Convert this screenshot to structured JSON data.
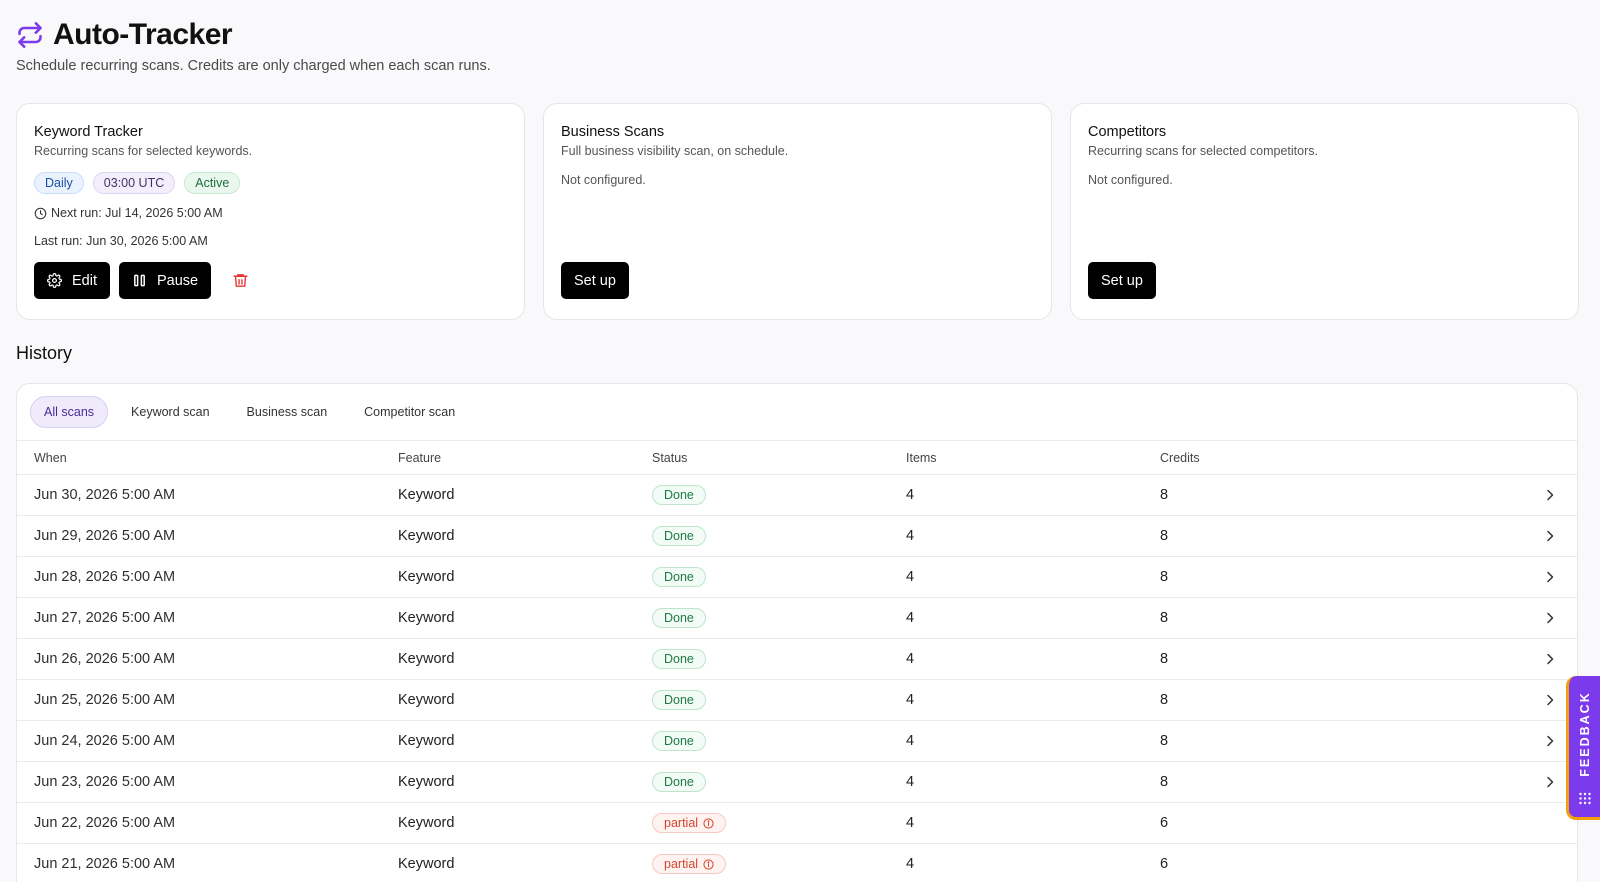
{
  "header": {
    "title": "Auto-Tracker",
    "subtitle": "Schedule recurring scans. Credits are only charged when each scan runs."
  },
  "cards": {
    "keyword": {
      "title": "Keyword Tracker",
      "description": "Recurring scans for selected keywords.",
      "tags": [
        "Daily",
        "03:00 UTC",
        "Active"
      ],
      "next_run": "Next run: Jul 14, 2026 5:00 AM",
      "last_run": "Last run: Jun 30, 2026 5:00 AM",
      "edit_label": "Edit",
      "pause_label": "Pause"
    },
    "business": {
      "title": "Business Scans",
      "description": "Full business visibility scan, on schedule.",
      "status": "Not configured.",
      "setup_label": "Set up"
    },
    "competitors": {
      "title": "Competitors",
      "description": "Recurring scans for selected competitors.",
      "status": "Not configured.",
      "setup_label": "Set up"
    }
  },
  "history": {
    "title": "History",
    "filters": [
      "All scans",
      "Keyword scan",
      "Business scan",
      "Competitor scan"
    ],
    "active_filter": "All scans",
    "columns": [
      "When",
      "Feature",
      "Status",
      "Items",
      "Credits"
    ],
    "rows": [
      {
        "when": "Jun 30, 2026 5:00 AM",
        "feature": "Keyword",
        "status": "Done",
        "items": "4",
        "credits": "8"
      },
      {
        "when": "Jun 29, 2026 5:00 AM",
        "feature": "Keyword",
        "status": "Done",
        "items": "4",
        "credits": "8"
      },
      {
        "when": "Jun 28, 2026 5:00 AM",
        "feature": "Keyword",
        "status": "Done",
        "items": "4",
        "credits": "8"
      },
      {
        "when": "Jun 27, 2026 5:00 AM",
        "feature": "Keyword",
        "status": "Done",
        "items": "4",
        "credits": "8"
      },
      {
        "when": "Jun 26, 2026 5:00 AM",
        "feature": "Keyword",
        "status": "Done",
        "items": "4",
        "credits": "8"
      },
      {
        "when": "Jun 25, 2026 5:00 AM",
        "feature": "Keyword",
        "status": "Done",
        "items": "4",
        "credits": "8"
      },
      {
        "when": "Jun 24, 2026 5:00 AM",
        "feature": "Keyword",
        "status": "Done",
        "items": "4",
        "credits": "8"
      },
      {
        "when": "Jun 23, 2026 5:00 AM",
        "feature": "Keyword",
        "status": "Done",
        "items": "4",
        "credits": "8"
      },
      {
        "when": "Jun 22, 2026 5:00 AM",
        "feature": "Keyword",
        "status": "partial",
        "items": "4",
        "credits": "6"
      },
      {
        "when": "Jun 21, 2026 5:00 AM",
        "feature": "Keyword",
        "status": "partial",
        "items": "4",
        "credits": "6"
      }
    ]
  },
  "feedback": {
    "label": "FEEDBACK"
  },
  "icons": {
    "title": "arrows-repeat-icon",
    "clock": "clock-icon",
    "edit": "gear-icon",
    "pause": "pause-icon",
    "delete": "trash-icon",
    "row": "chevron-right-icon",
    "partial": "info-icon",
    "feedback": "grip-icon"
  },
  "colors": {
    "accent": "#7c3aed",
    "done": "#1e7a45",
    "partial": "#d2462f",
    "delete": "#e53935",
    "feedback_border": "#f59e0b"
  }
}
